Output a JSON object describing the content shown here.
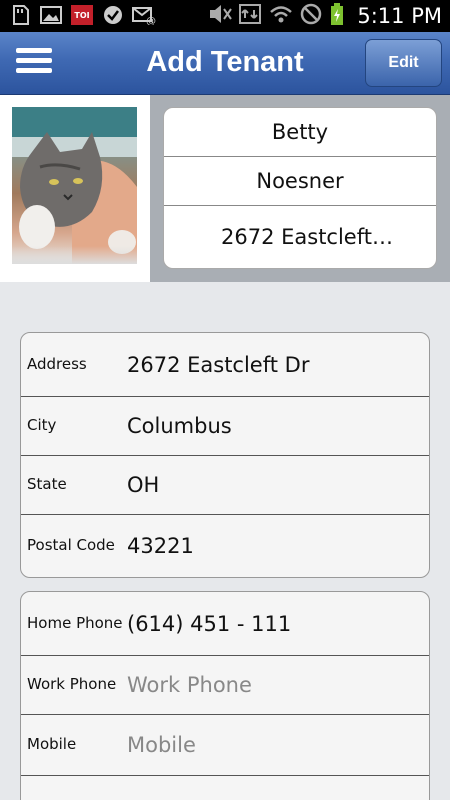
{
  "status_bar": {
    "time": "5:11 PM",
    "notification_icons": [
      "sd-card-icon",
      "image-icon",
      "toi-app-icon",
      "check-icon",
      "email-icon"
    ],
    "system_icons": [
      "mute-icon",
      "data-icon",
      "wifi-icon",
      "no-signal-icon",
      "battery-charging-icon"
    ],
    "toi_label": "TOI"
  },
  "navbar": {
    "title": "Add Tenant",
    "edit_label": "Edit"
  },
  "profile": {
    "first_name": "Betty",
    "last_name": "Noesner",
    "address_preview": "2672 Eastcleft…"
  },
  "address_card": {
    "rows": [
      {
        "label": "Address",
        "value": "2672 Eastcleft Dr"
      },
      {
        "label": "City",
        "value": "Columbus"
      },
      {
        "label": "State",
        "value": "OH"
      },
      {
        "label": "Postal Code",
        "value": "43221"
      }
    ]
  },
  "phone_card": {
    "rows": [
      {
        "label": "Home Phone",
        "value": "(614) 451 - 111",
        "placeholder": false
      },
      {
        "label": "Work Phone",
        "value": "Work Phone",
        "placeholder": true
      },
      {
        "label": "Mobile",
        "value": "Mobile",
        "placeholder": true
      }
    ]
  },
  "colors": {
    "navbar_top": "#5b85c9",
    "navbar_bottom": "#2c549e",
    "background": "#e6e8eb",
    "header_bg": "#a9aeb4"
  }
}
